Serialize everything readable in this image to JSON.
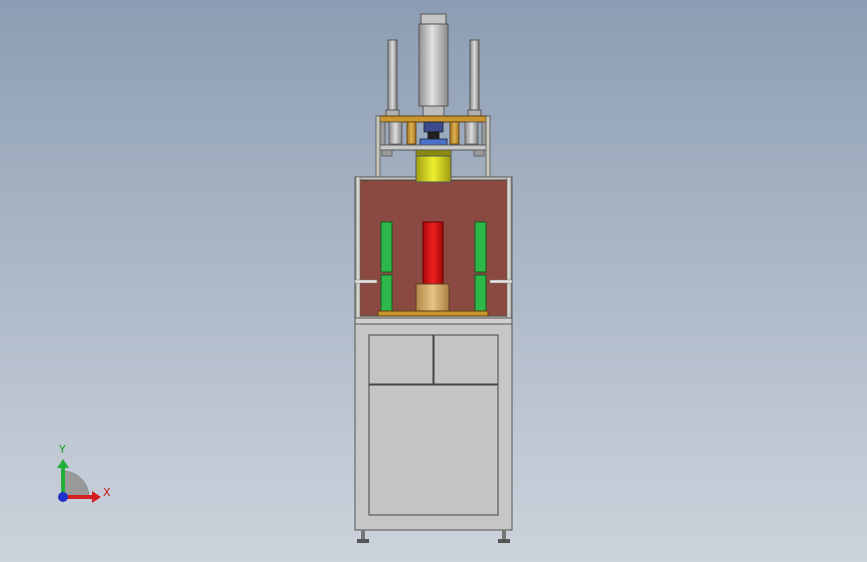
{
  "scene": {
    "type": "CAD model viewport",
    "background": "#aab6c6"
  },
  "triad": {
    "x_label": "X",
    "y_label": "Y",
    "x_color": "#d42020",
    "y_color": "#22b03a",
    "z_color": "#2233cc"
  },
  "colors": {
    "frame": "#c8c8b8",
    "panel": "#8a4a42",
    "green_guides": "#2fb84a",
    "yellow_cylinder": "#d4d81a",
    "red_ram": "#d81a1a",
    "tan_die": "#d8b070",
    "cabinet": "#c6c6c6",
    "top_bar": "#c8952e"
  }
}
